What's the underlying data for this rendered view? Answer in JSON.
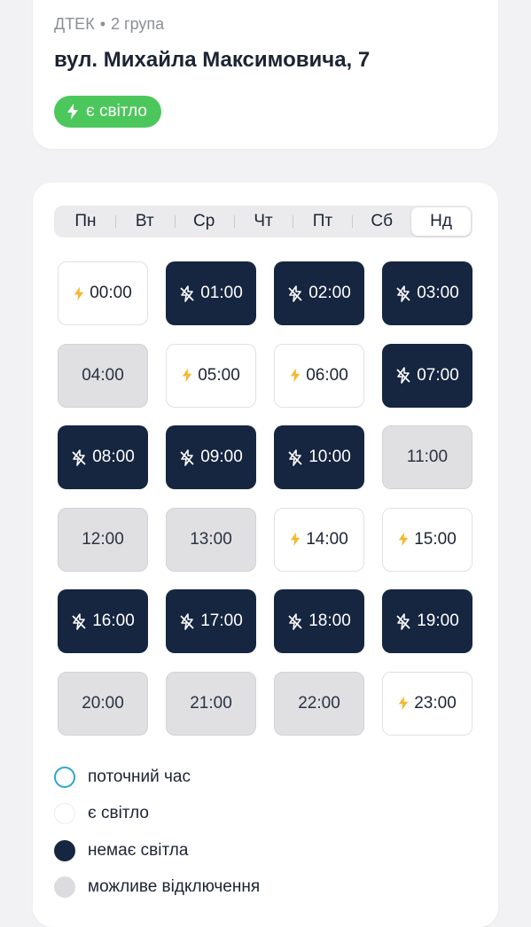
{
  "header": {
    "provider": "ДТЕК",
    "separator": "•",
    "group": "2 група",
    "address": "вул. Михайла Максимовича, 7",
    "status_label": "є світло",
    "status_icon": "bolt-icon"
  },
  "colors": {
    "status_green": "#4cc75b",
    "no_power": "#162540",
    "maybe": "#e0e0e3",
    "bolt": "#f5b82e",
    "current_ring": "#2aa6cf"
  },
  "days": [
    {
      "label": "Пн",
      "active": false
    },
    {
      "label": "Вт",
      "active": false
    },
    {
      "label": "Ср",
      "active": false
    },
    {
      "label": "Чт",
      "active": false
    },
    {
      "label": "Пт",
      "active": false
    },
    {
      "label": "Сб",
      "active": false
    },
    {
      "label": "Нд",
      "active": true
    }
  ],
  "slots": [
    {
      "time": "00:00",
      "state": "on"
    },
    {
      "time": "01:00",
      "state": "off"
    },
    {
      "time": "02:00",
      "state": "off"
    },
    {
      "time": "03:00",
      "state": "off"
    },
    {
      "time": "04:00",
      "state": "maybe"
    },
    {
      "time": "05:00",
      "state": "on"
    },
    {
      "time": "06:00",
      "state": "on"
    },
    {
      "time": "07:00",
      "state": "off"
    },
    {
      "time": "08:00",
      "state": "off"
    },
    {
      "time": "09:00",
      "state": "off"
    },
    {
      "time": "10:00",
      "state": "off"
    },
    {
      "time": "11:00",
      "state": "maybe"
    },
    {
      "time": "12:00",
      "state": "maybe"
    },
    {
      "time": "13:00",
      "state": "maybe"
    },
    {
      "time": "14:00",
      "state": "on"
    },
    {
      "time": "15:00",
      "state": "on"
    },
    {
      "time": "16:00",
      "state": "off"
    },
    {
      "time": "17:00",
      "state": "off"
    },
    {
      "time": "18:00",
      "state": "off"
    },
    {
      "time": "19:00",
      "state": "off"
    },
    {
      "time": "20:00",
      "state": "maybe"
    },
    {
      "time": "21:00",
      "state": "maybe"
    },
    {
      "time": "22:00",
      "state": "maybe"
    },
    {
      "time": "23:00",
      "state": "on"
    }
  ],
  "legend": [
    {
      "label": "поточний час",
      "kind": "current"
    },
    {
      "label": "є світло",
      "kind": "on"
    },
    {
      "label": "немає світла",
      "kind": "off"
    },
    {
      "label": "можливе відключення",
      "kind": "maybe"
    }
  ]
}
